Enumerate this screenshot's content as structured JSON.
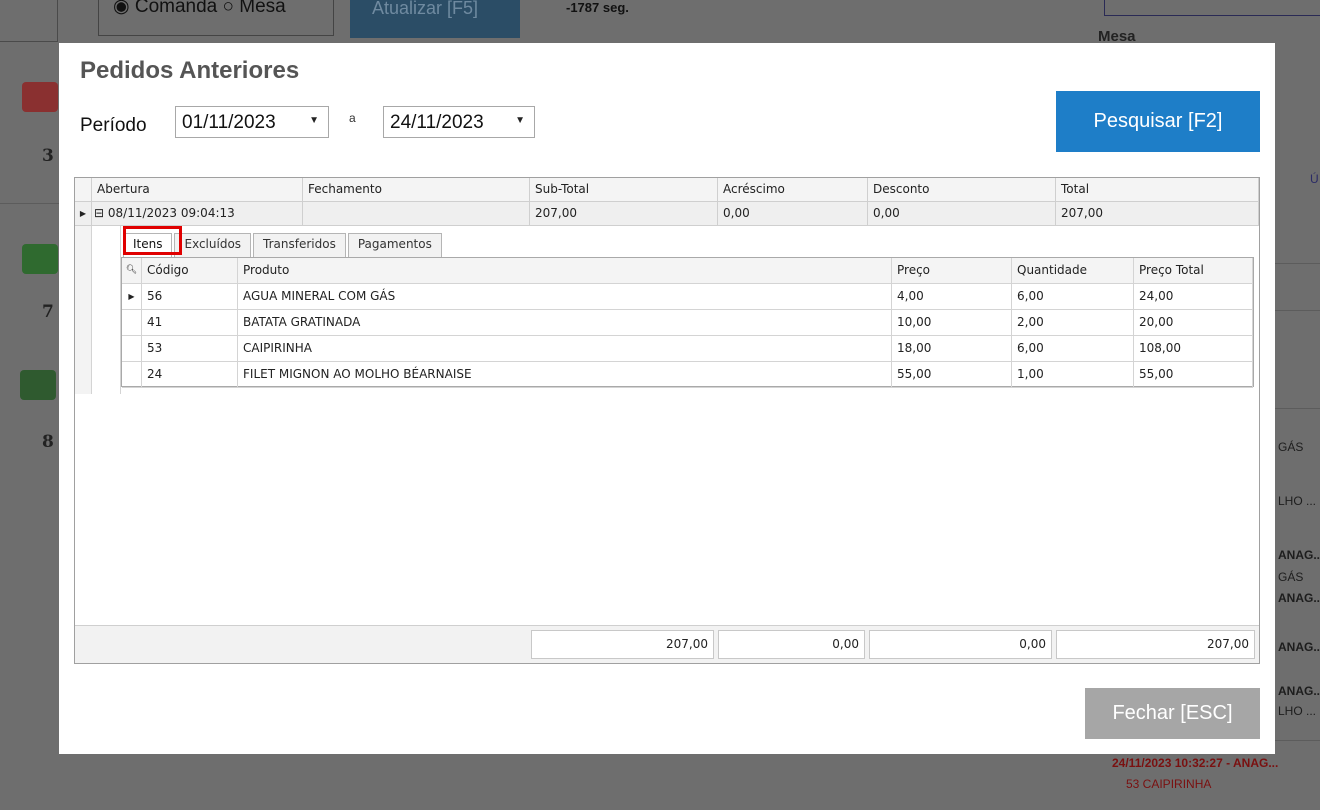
{
  "background": {
    "radio_text": "◉ Comanda ○ Mesa",
    "update_button": "Atualizar [F5]",
    "seconds": "-1787 seg.",
    "mesa_label": "Mesa",
    "numbers": [
      "3",
      "7",
      "8"
    ],
    "right_texts": [
      "GÁS",
      "LHO ...",
      "ANAG...",
      "GÁS",
      "ANAG...",
      "ANAG...",
      "ANAG...",
      "LHO ..."
    ],
    "right_u": "Ú",
    "bottom_timestamp": "24/11/2023 10:32:27 - ANAG...",
    "bottom_item": "53 CAIPIRINHA"
  },
  "dialog": {
    "title": "Pedidos Anteriores",
    "period_label": "Período",
    "date_from": "01/11/2023",
    "date_sep": "a",
    "date_to": "24/11/2023",
    "search_button": "Pesquisar [F2]",
    "close_button": "Fechar [ESC]",
    "colors": {
      "search_button": "#1e7ec8",
      "close_button": "#a6a6a6",
      "highlight": "#e00000"
    }
  },
  "master": {
    "columns": [
      "Abertura",
      "Fechamento",
      "Sub-Total",
      "Acréscimo",
      "Desconto",
      "Total"
    ],
    "row": {
      "expander": "⊟",
      "abertura": "08/11/2023 09:04:13",
      "fechamento": "",
      "subtotal": "207,00",
      "acrescimo": "0,00",
      "desconto": "0,00",
      "total": "207,00"
    }
  },
  "tabs": [
    "Itens",
    "Excluídos",
    "Transferidos",
    "Pagamentos"
  ],
  "detail": {
    "columns": [
      "Código",
      "Produto",
      "Preço",
      "Quantidade",
      "Preço Total"
    ],
    "rows": [
      {
        "codigo": "56",
        "produto": "AGUA MINERAL COM GÁS",
        "preco": "4,00",
        "quantidade": "6,00",
        "total": "24,00"
      },
      {
        "codigo": "41",
        "produto": "BATATA GRATINADA",
        "preco": "10,00",
        "quantidade": "2,00",
        "total": "20,00"
      },
      {
        "codigo": "53",
        "produto": "CAIPIRINHA",
        "preco": "18,00",
        "quantidade": "6,00",
        "total": "108,00"
      },
      {
        "codigo": "24",
        "produto": "FILET MIGNON AO MOLHO BÉARNAISE",
        "preco": "55,00",
        "quantidade": "1,00",
        "total": "55,00"
      }
    ]
  },
  "footer_totals": {
    "subtotal": "207,00",
    "acrescimo": "0,00",
    "desconto": "0,00",
    "total": "207,00"
  }
}
